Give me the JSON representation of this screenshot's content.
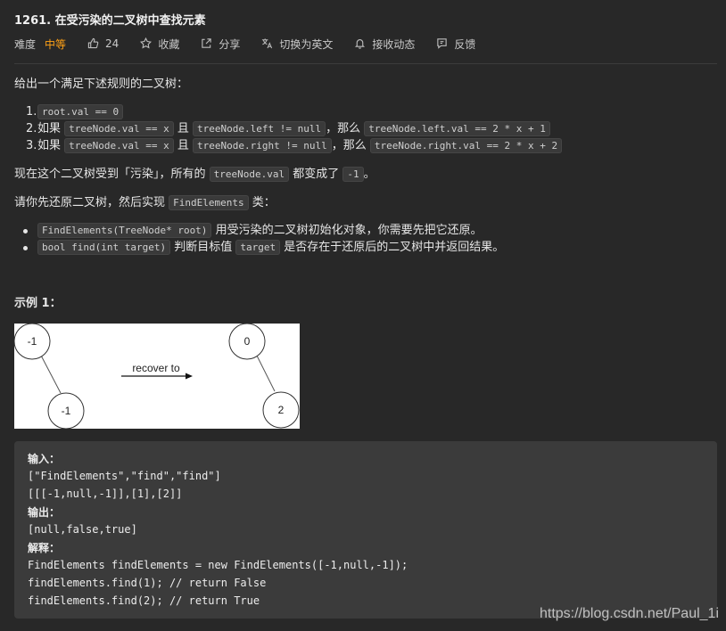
{
  "header": {
    "title": "1261. 在受污染的二叉树中查找元素",
    "difficulty_label": "难度",
    "difficulty": "中等",
    "likes": "24",
    "favorite": "收藏",
    "share": "分享",
    "switch_lang": "切换为英文",
    "notify": "接收动态",
    "feedback": "反馈",
    "difficulty_color": "#ffa116"
  },
  "description": {
    "intro": "给出一个满足下述规则的二叉树：",
    "rules": [
      {
        "num": "1.",
        "pre": "",
        "code1": "root.val == 0",
        "mid": "",
        "code2": "",
        "mid2": "",
        "code3": ""
      },
      {
        "num": "2.",
        "pre": "如果 ",
        "code1": "treeNode.val == x",
        "mid": " 且 ",
        "code2": "treeNode.left != null",
        "mid2": "，那么 ",
        "code3": "treeNode.left.val == 2 * x + 1"
      },
      {
        "num": "3.",
        "pre": "如果 ",
        "code1": "treeNode.val == x",
        "mid": " 且 ",
        "code2": "treeNode.right != null",
        "mid2": "，那么 ",
        "code3": "treeNode.right.val == 2 * x + 2"
      }
    ],
    "contaminated": {
      "pre": "现在这个二叉树受到「污染」，所有的 ",
      "code1": "treeNode.val",
      "mid": " 都变成了 ",
      "code2": "-1",
      "post": "。"
    },
    "task": {
      "pre": "请你先还原二叉树，然后实现 ",
      "code": "FindElements",
      "post": " 类："
    },
    "methods": [
      {
        "code": "FindElements(TreeNode* root)",
        "mid": " 用受污染的二叉树初始化对象，你需要先把它还原。",
        "code2": "",
        "post": ""
      },
      {
        "code": "bool find(int target)",
        "mid": " 判断目标值 ",
        "code2": "target",
        "post": " 是否存在于还原后的二叉树中并返回结果。"
      }
    ]
  },
  "example": {
    "heading": "示例 1：",
    "diagram": {
      "left_root": "-1",
      "left_child": "-1",
      "arrow_label": "recover to",
      "right_root": "0",
      "right_child": "2"
    },
    "code_lines": [
      {
        "text": "输入：",
        "bold": true
      },
      {
        "text": "[\"FindElements\",\"find\",\"find\"]",
        "bold": false
      },
      {
        "text": "[[[-1,null,-1]],[1],[2]]",
        "bold": false
      },
      {
        "text": "输出：",
        "bold": true
      },
      {
        "text": "[null,false,true]",
        "bold": false
      },
      {
        "text": "解释：",
        "bold": true
      },
      {
        "text": "FindElements findElements = new FindElements([-1,null,-1]);",
        "bold": false
      },
      {
        "text": "findElements.find(1); // return False",
        "bold": false
      },
      {
        "text": "findElements.find(2); // return True",
        "bold": false
      }
    ]
  },
  "watermark": "https://blog.csdn.net/Paul_1i"
}
